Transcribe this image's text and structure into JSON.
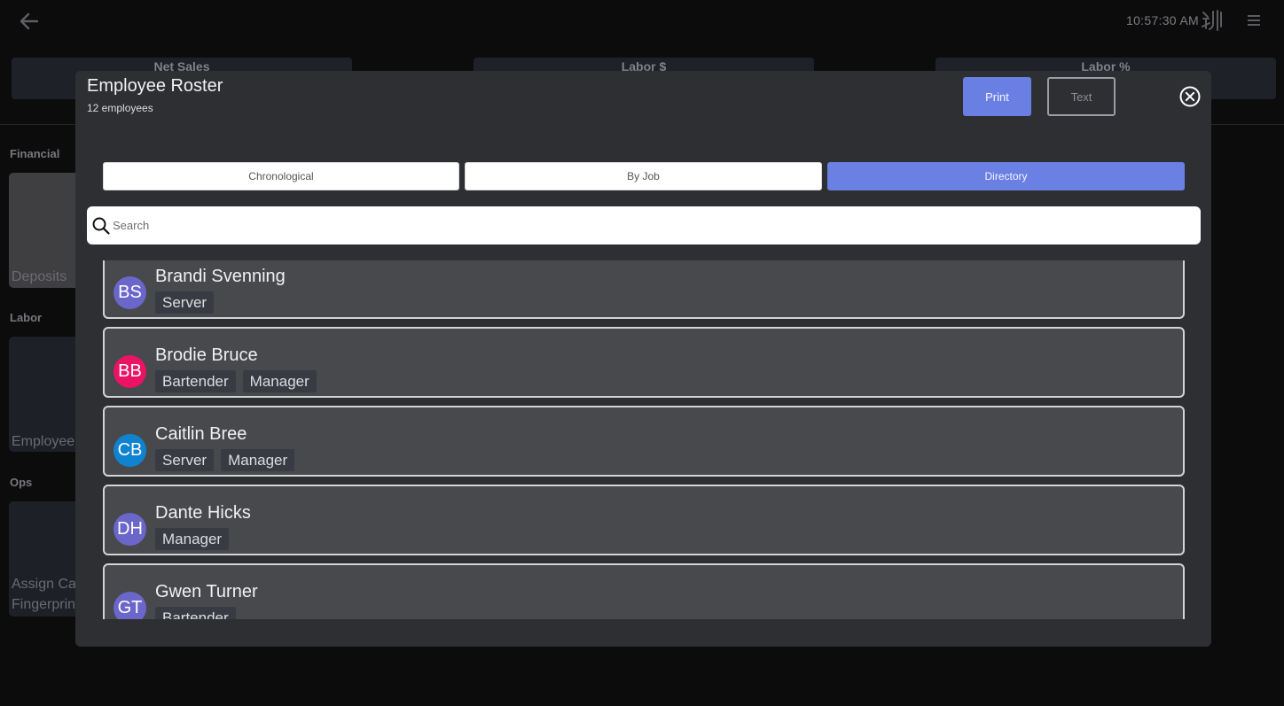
{
  "header": {
    "clock": "10:57:30 AM"
  },
  "stats": [
    {
      "label": "Net Sales"
    },
    {
      "label": "Labor $"
    },
    {
      "label": "Labor %"
    }
  ],
  "sections": {
    "financial": "Financial",
    "labor": "Labor",
    "ops": "Ops"
  },
  "tiles": {
    "deposits": "Deposits",
    "employees": "Employee",
    "assign": "Assign Ca\nFingerprin"
  },
  "modal": {
    "title": "Employee Roster",
    "subtitle": "12 employees",
    "print_label": "Print",
    "text_label": "Text",
    "tabs": [
      "Chronological",
      "By Job",
      "Directory"
    ],
    "active_tab": "Directory",
    "search_placeholder": "Search"
  },
  "employees": [
    {
      "initials": "BS",
      "name": "Brandi Svenning",
      "avatar_color": "#6b66c9",
      "jobs": [
        "Server"
      ]
    },
    {
      "initials": "BB",
      "name": "Brodie Bruce",
      "avatar_color": "#ea1364",
      "jobs": [
        "Bartender",
        "Manager"
      ]
    },
    {
      "initials": "CB",
      "name": "Caitlin Bree",
      "avatar_color": "#1083d0",
      "jobs": [
        "Server",
        "Manager"
      ]
    },
    {
      "initials": "DH",
      "name": "Dante Hicks",
      "avatar_color": "#6b66c9",
      "jobs": [
        "Manager"
      ]
    },
    {
      "initials": "GT",
      "name": "Gwen Turner",
      "avatar_color": "#6b66c9",
      "jobs": [
        "Bartender"
      ]
    }
  ],
  "colors": {
    "accent": "#6a7fe3",
    "modal_bg": "#2e2f33",
    "card_bg": "#48494d"
  },
  "icons": {
    "back": "back-arrow-icon",
    "logo": "brand-logo-icon",
    "menu": "hamburger-menu-icon",
    "close": "close-circle-icon",
    "search": "search-icon"
  }
}
